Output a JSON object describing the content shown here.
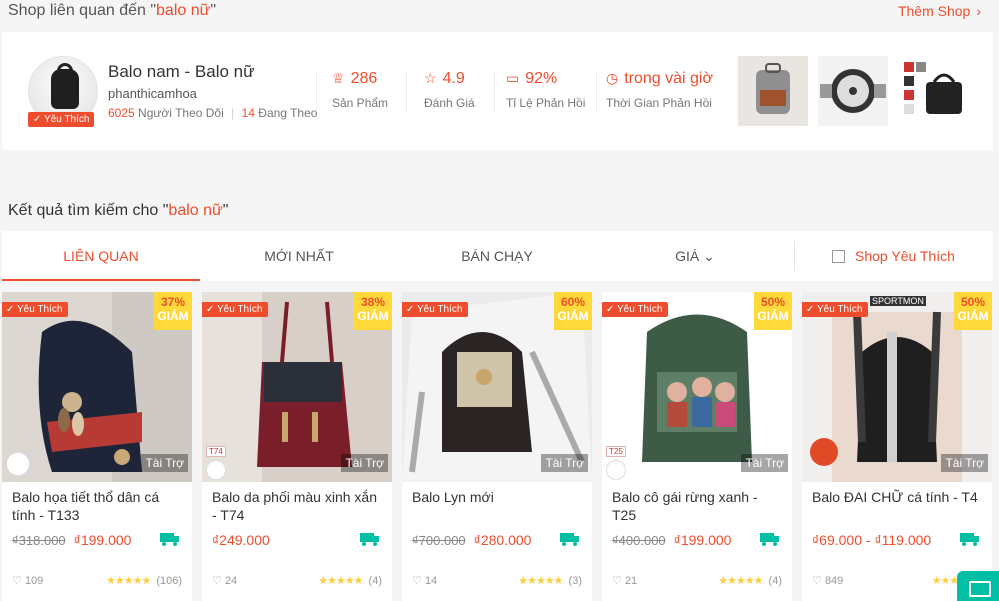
{
  "shop_section": {
    "title_prefix": "Shop liên quan đến \"",
    "keyword": "balo nữ",
    "title_suffix": "\"",
    "more_label": "Thêm Shop",
    "shop": {
      "name": "Balo nam - Balo nữ",
      "handle": "phanthicamhoa",
      "preferred_label": "Yêu Thích",
      "followers": "6025",
      "followers_label": "Người Theo Dõi",
      "following": "14",
      "following_label": "Đang Theo",
      "stats": [
        {
          "value": "286",
          "label": "Sản Phẩm",
          "icon": "hat-icon"
        },
        {
          "value": "4.9",
          "label": "Đánh Giá",
          "icon": "star-outline-icon"
        },
        {
          "value": "92%",
          "label": "Tỉ Lệ Phản Hồi",
          "icon": "chat-bubble-icon"
        },
        {
          "value": "trong vài giờ",
          "label": "Thời Gian Phản Hồi",
          "icon": "clock-icon"
        }
      ]
    }
  },
  "results": {
    "title_prefix": "Kết quả tìm kiếm cho \"",
    "keyword": "balo nữ",
    "title_suffix": "\""
  },
  "sort_bar": {
    "tabs": [
      "LIÊN QUAN",
      "MỚI NHẤT",
      "BÁN CHẠY",
      "GIÁ"
    ],
    "active_index": 0,
    "fav_filter": "Shop Yêu Thích"
  },
  "products": [
    {
      "name": "Balo họa tiết thổ dân cá tính - T133",
      "discount": "37%",
      "discount_label": "GIẢM",
      "preferred": "Yêu Thích",
      "sponsored": "Tài Trợ",
      "old_price": "₫318.000",
      "price": "₫199.000",
      "likes": "109",
      "rating_count": "(106)",
      "free_label": "Free",
      "tag": ""
    },
    {
      "name": "Balo da phối màu xinh xắn - T74",
      "discount": "38%",
      "discount_label": "GIẢM",
      "preferred": "Yêu Thích",
      "sponsored": "Tài Trợ",
      "old_price": "",
      "price": "₫249.000",
      "likes": "24",
      "rating_count": "(4)",
      "free_label": "Free",
      "tag": "T74"
    },
    {
      "name": "Balo Lyn mới",
      "discount": "60%",
      "discount_label": "GIẢM",
      "preferred": "Yêu Thích",
      "sponsored": "Tài Trợ",
      "old_price": "₫700.000",
      "price": "₫280.000",
      "likes": "14",
      "rating_count": "(3)",
      "free_label": "Free",
      "tag": ""
    },
    {
      "name": "Balo cô gái rừng xanh - T25",
      "discount": "50%",
      "discount_label": "GIẢM",
      "preferred": "Yêu Thích",
      "sponsored": "Tài Trợ",
      "old_price": "₫400.000",
      "price": "₫199.000",
      "likes": "21",
      "rating_count": "(4)",
      "free_label": "Free",
      "tag": "T25"
    },
    {
      "name": "Balo ĐAI CHỮ cá tính - T4",
      "discount": "50%",
      "discount_label": "GIẢM",
      "preferred": "Yêu Thích",
      "sponsored": "Tài Trợ",
      "old_price": "",
      "price": "₫69.000 - ₫119.000",
      "likes": "849",
      "rating_count": "",
      "free_label": "Free",
      "tag": "SPORTMON"
    }
  ],
  "rating_stars": "★★★★★",
  "colors": {
    "accent": "#ee4d2d",
    "discount_bg": "#ffd839",
    "chat": "#00bfa5"
  }
}
